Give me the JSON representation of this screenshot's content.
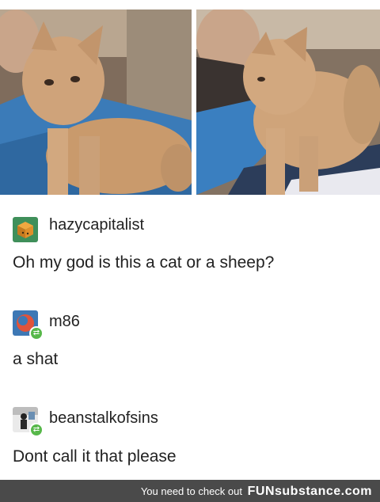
{
  "photos": [
    {
      "alt_icon": "curly-kitten-photo-1"
    },
    {
      "alt_icon": "curly-kitten-photo-2"
    }
  ],
  "posts": [
    {
      "username": "hazycapitalist",
      "text": "Oh my god is this a cat or a sheep?",
      "avatar_icon": "cube-avatar-icon",
      "reblog": false
    },
    {
      "username": "m86",
      "text": "a shat",
      "avatar_icon": "orange-circle-avatar-icon",
      "reblog": true
    },
    {
      "username": "beanstalkofsins",
      "text": "Dont call it that please",
      "avatar_icon": "figure-avatar-icon",
      "reblog": true
    }
  ],
  "footer": {
    "text": "You need to check out",
    "brand": "FUNsubstance.com"
  },
  "colors": {
    "reblog_badge": "#57b84a",
    "footer_bg": "#4a4a4a",
    "divider": "#e4e4e4"
  }
}
